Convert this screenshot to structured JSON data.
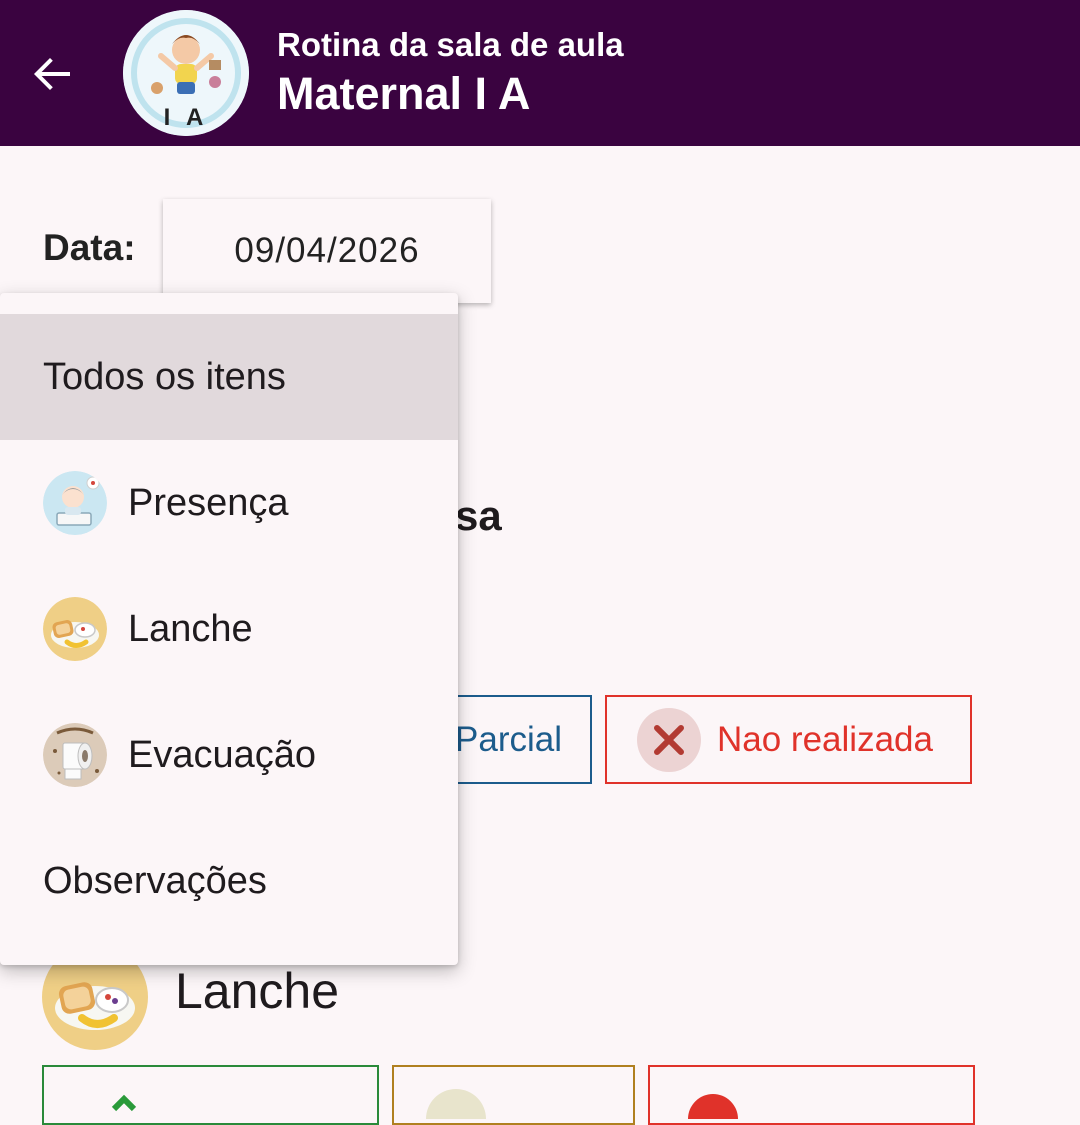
{
  "header": {
    "subtitle": "Rotina da sala de aula",
    "title": "Maternal I A",
    "avatar_letters": "I A",
    "background": "#3a0340"
  },
  "date_filter": {
    "label": "Data:",
    "value": "09/04/2026"
  },
  "background_content": {
    "partial_title_fragment": "sa",
    "chips": {
      "parcial": "Parcial",
      "nao_realizada": "Nao realizada"
    },
    "section_lanche_title": "Lanche"
  },
  "dropdown_menu": {
    "items": [
      {
        "label": "Todos os itens",
        "icon": "",
        "selected": true
      },
      {
        "label": "Presença",
        "icon": "child-reading-icon",
        "selected": false
      },
      {
        "label": "Lanche",
        "icon": "breakfast-plate-icon",
        "selected": false
      },
      {
        "label": "Evacuação",
        "icon": "toilet-paper-icon",
        "selected": false
      },
      {
        "label": "Observações",
        "icon": "",
        "selected": false
      }
    ]
  },
  "colors": {
    "accent_blue": "#1c5c8c",
    "accent_red": "#e0322a",
    "accent_green": "#2a8a3a",
    "accent_gold": "#b08020",
    "selected_row": "#e1d9dc"
  }
}
